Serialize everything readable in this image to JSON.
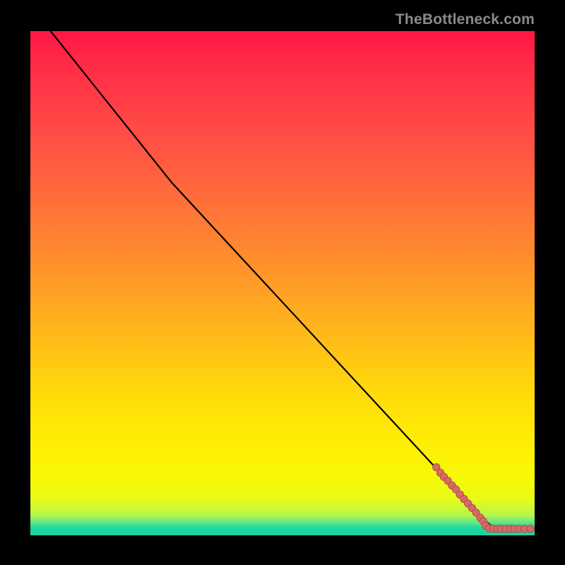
{
  "watermark": "TheBottleneck.com",
  "colors": {
    "dot_fill": "#d46a65",
    "dot_stroke": "#b24f4a",
    "curve": "#000000",
    "gradient_top": "#ff1744",
    "gradient_bottom": "#19d3a5"
  },
  "chart_data": {
    "type": "line",
    "title": "",
    "xlabel": "",
    "ylabel": "",
    "xlim": [
      0,
      100
    ],
    "ylim": [
      0,
      100
    ],
    "grid": false,
    "legend": false,
    "curve_points": [
      {
        "x": 4,
        "y": 100
      },
      {
        "x": 28,
        "y": 70
      },
      {
        "x": 90,
        "y": 3
      },
      {
        "x": 92,
        "y": 1.5
      },
      {
        "x": 100,
        "y": 1.3
      }
    ],
    "scatter_points": [
      {
        "x": 80.5,
        "y": 13.5
      },
      {
        "x": 81.3,
        "y": 12.4
      },
      {
        "x": 82.0,
        "y": 11.6
      },
      {
        "x": 82.8,
        "y": 10.8
      },
      {
        "x": 83.6,
        "y": 9.9
      },
      {
        "x": 84.4,
        "y": 9.1
      },
      {
        "x": 85.2,
        "y": 8.1
      },
      {
        "x": 86.0,
        "y": 7.2
      },
      {
        "x": 86.8,
        "y": 6.3
      },
      {
        "x": 87.6,
        "y": 5.4
      },
      {
        "x": 88.4,
        "y": 4.5
      },
      {
        "x": 89.2,
        "y": 3.5
      },
      {
        "x": 89.8,
        "y": 2.8
      },
      {
        "x": 90.3,
        "y": 1.9
      },
      {
        "x": 91.0,
        "y": 1.4
      },
      {
        "x": 91.8,
        "y": 1.3
      },
      {
        "x": 92.6,
        "y": 1.3
      },
      {
        "x": 93.3,
        "y": 1.3
      },
      {
        "x": 94.3,
        "y": 1.3
      },
      {
        "x": 95.2,
        "y": 1.3
      },
      {
        "x": 96.0,
        "y": 1.3
      },
      {
        "x": 97.0,
        "y": 1.3
      },
      {
        "x": 98.0,
        "y": 1.3
      },
      {
        "x": 99.2,
        "y": 1.3
      }
    ]
  }
}
